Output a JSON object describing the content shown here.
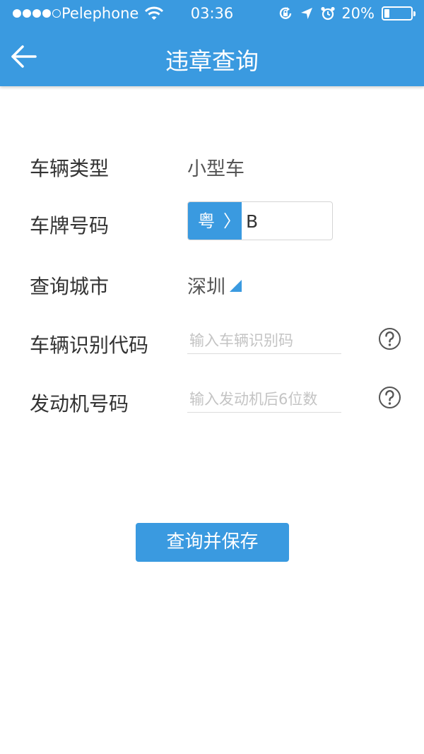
{
  "status_bar": {
    "carrier": "Pelephone",
    "time": "03:36",
    "battery": "20%",
    "battery_level": 0.2,
    "signal_dots": 4,
    "icons": [
      "wifi-icon",
      "rotation-lock-icon",
      "location-arrow-icon",
      "alarm-icon",
      "battery-icon"
    ]
  },
  "nav": {
    "title": "违章查询",
    "back_icon": "back-arrow-icon"
  },
  "form": {
    "vehicle_type": {
      "label": "车辆类型",
      "value": "小型车"
    },
    "plate": {
      "label": "车牌号码",
      "province": "粤",
      "chevron": "〉",
      "value": "B"
    },
    "city": {
      "label": "查询城市",
      "value": "深圳"
    },
    "vin": {
      "label": "车辆识别代码",
      "placeholder": "输入车辆识别码",
      "help_icon": "question-circle-icon"
    },
    "engine": {
      "label": "发动机号码",
      "placeholder": "输入发动机后6位数",
      "help_icon": "question-circle-icon"
    }
  },
  "submit": {
    "label": "查询并保存"
  },
  "colors": {
    "accent": "#3a9ae0",
    "label_text": "#333333",
    "placeholder": "#c4c4c4"
  }
}
